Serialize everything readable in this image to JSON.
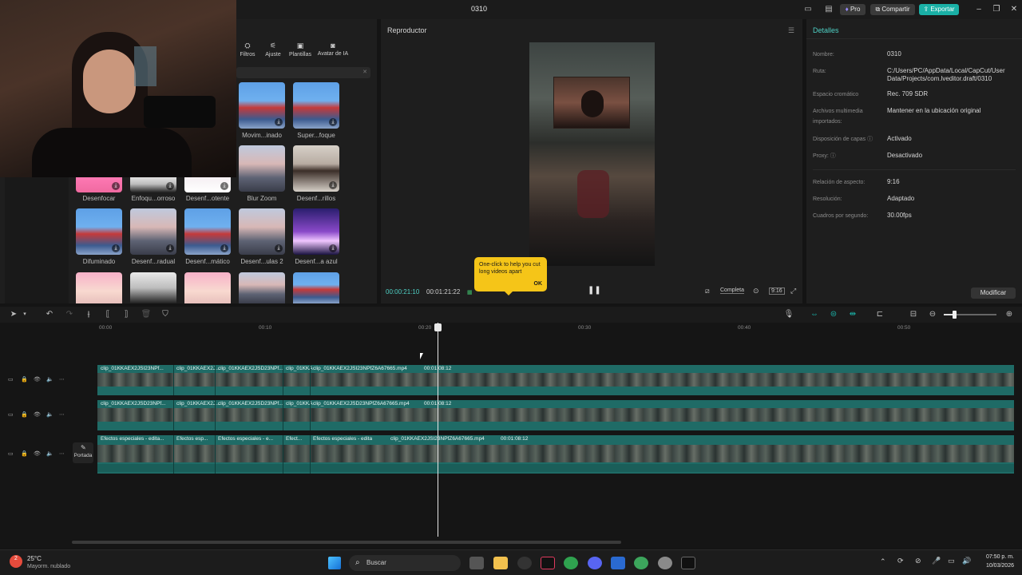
{
  "titlebar": {
    "title": "0310",
    "pro_label": "Pro",
    "share_label": "Compartir",
    "export_label": "Exportar",
    "accent_color": "#1ab0a6"
  },
  "left_panel": {
    "tabs": [
      {
        "label": "Filtros",
        "icon": "filter-icon"
      },
      {
        "label": "Ajuste",
        "icon": "sliders-icon"
      },
      {
        "label": "Plantillas",
        "icon": "template-icon"
      },
      {
        "label": "Avatar de IA",
        "icon": "ai-avatar-icon"
      }
    ],
    "effects": [
      {
        "label": "Movim...inado"
      },
      {
        "label": "Super...foque"
      },
      {
        "label": "Blur Zoom"
      },
      {
        "label": "Desenf...rillos"
      },
      {
        "label": "Desenfocar"
      },
      {
        "label": "Enfoqu...orroso"
      },
      {
        "label": "Desenf...otente"
      },
      {
        "label": "Difuminado"
      },
      {
        "label": "Desenf...radual"
      },
      {
        "label": "Desenf...mático"
      },
      {
        "label": "Desenf...ulas 2"
      },
      {
        "label": "Desenf...a azul"
      }
    ]
  },
  "player": {
    "title": "Reproductor",
    "current_time": "00:00:21:10",
    "total_time": "00:01:21:22",
    "full_label": "Completa",
    "ratio_label": "9:16",
    "tooltip": {
      "text": "One-click to help you cut long videos apart",
      "ok": "OK"
    }
  },
  "details": {
    "title": "Detalles",
    "rows": [
      {
        "key": "Nombre:",
        "value": "0310"
      },
      {
        "key": "Ruta:",
        "value": "C:/Users/PC/AppData/Local/CapCut/User Data/Projects/com.lveditor.draft/0310"
      },
      {
        "key": "Espacio cromático",
        "value": "Rec. 709 SDR"
      },
      {
        "key": "Archivos multimedia importados:",
        "value": "Mantener en la ubicación original"
      },
      {
        "key": "Disposición de capas",
        "value": "Activado"
      },
      {
        "key": "Proxy:",
        "value": "Desactivado"
      },
      {
        "key": "Relación de aspecto:",
        "value": "9:16"
      },
      {
        "key": "Resolución:",
        "value": "Adaptado"
      },
      {
        "key": "Cuadros por segundo:",
        "value": "30.00fps"
      }
    ],
    "modify_label": "Modificar"
  },
  "timeline": {
    "ruler": [
      "00:00",
      "00:10",
      "00:20",
      "00:30",
      "00:40",
      "00:50"
    ],
    "tracks": [
      {
        "clips": [
          "clip_01KKAEX2JSI23NPf...",
          "clip_01KKAEX2J...",
          "clip_01KKAEX2JSD23NPf...",
          "clip_01KKA",
          "clip_01KKAEX2JSI23NPfZ6A67665.mp4",
          "00:01:08:12"
        ]
      },
      {
        "clips": [
          "clip_01KKAEX2JSD23NPf...",
          "clip_01KKAEX2J...",
          "clip_01KKAEX2JSD23NPf...",
          "clip_01KKA",
          "clip_01KKAEX2JSD23NPfZ6A67665.mp4",
          "00:01:08:12"
        ]
      },
      {
        "clips": [
          "Efectos especiales - edita...",
          "Efectos esp...",
          "Efectos especiales - e...",
          "Efect...",
          "Efectos especiales - edita",
          "clip_01KKAEX2JSI23NPfZ6A67665.mp4",
          "00:01:08:12"
        ]
      }
    ],
    "cover_label": "Portada"
  },
  "taskbar": {
    "weather_temp": "25°C",
    "weather_desc": "Mayorm. nublado",
    "search_placeholder": "Buscar",
    "time": "07:50 p. m.",
    "date": "10/03/2026",
    "badge": "2"
  }
}
